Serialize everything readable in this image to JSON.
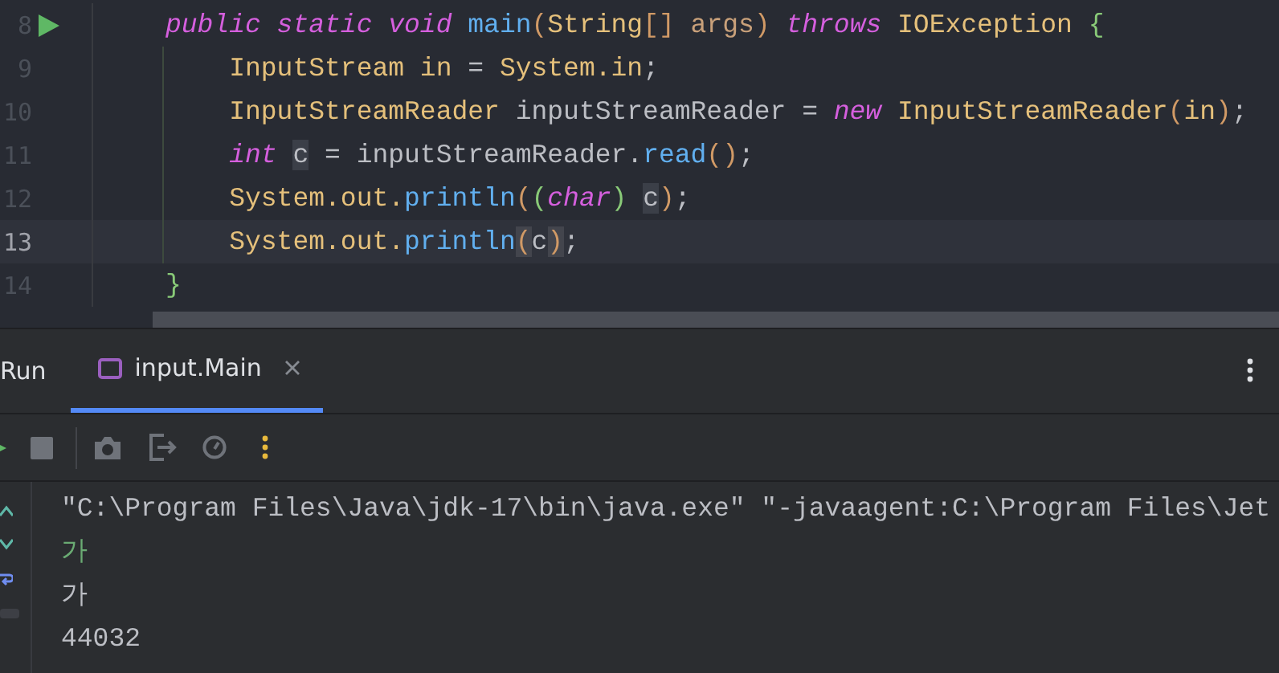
{
  "editor": {
    "lines": [
      {
        "number": "8",
        "current": false,
        "runnable": true,
        "tokens": [
          {
            "kind": "keyword",
            "text": "public static void "
          },
          {
            "kind": "method",
            "text": "main"
          },
          {
            "kind": "paren",
            "text": "("
          },
          {
            "kind": "type",
            "text": "String"
          },
          {
            "kind": "paren",
            "text": "[] "
          },
          {
            "kind": "param",
            "text": "args"
          },
          {
            "kind": "paren",
            "text": ") "
          },
          {
            "kind": "keyword",
            "text": "throws "
          },
          {
            "kind": "type",
            "text": "IOException "
          },
          {
            "kind": "brace",
            "text": "{"
          }
        ]
      },
      {
        "number": "9",
        "current": false,
        "runnable": false,
        "tokens": [
          {
            "kind": "type",
            "text": "    InputStream in"
          },
          {
            "kind": "plain",
            "text": " = "
          },
          {
            "kind": "type",
            "text": "System.in"
          },
          {
            "kind": "plain",
            "text": ";"
          }
        ]
      },
      {
        "number": "10",
        "current": false,
        "runnable": false,
        "tokens": [
          {
            "kind": "type",
            "text": "    InputStreamReader"
          },
          {
            "kind": "plain",
            "text": " inputStreamReader = "
          },
          {
            "kind": "keyword",
            "text": "new "
          },
          {
            "kind": "type",
            "text": "InputStreamReader"
          },
          {
            "kind": "paren",
            "text": "("
          },
          {
            "kind": "type",
            "text": "in"
          },
          {
            "kind": "paren",
            "text": ")"
          },
          {
            "kind": "plain",
            "text": ";"
          }
        ]
      },
      {
        "number": "11",
        "current": false,
        "runnable": false,
        "tokens": [
          {
            "kind": "keyword",
            "text": "    int "
          },
          {
            "kind": "highlight-var",
            "text": "c"
          },
          {
            "kind": "plain",
            "text": " = inputStreamReader."
          },
          {
            "kind": "method",
            "text": "read"
          },
          {
            "kind": "paren",
            "text": "()"
          },
          {
            "kind": "plain",
            "text": ";"
          }
        ]
      },
      {
        "number": "12",
        "current": false,
        "runnable": false,
        "tokens": [
          {
            "kind": "type",
            "text": "    System.out."
          },
          {
            "kind": "method",
            "text": "println"
          },
          {
            "kind": "paren",
            "text": "("
          },
          {
            "kind": "brace",
            "text": "("
          },
          {
            "kind": "keyword",
            "text": "char"
          },
          {
            "kind": "brace",
            "text": ") "
          },
          {
            "kind": "highlight-var",
            "text": "c"
          },
          {
            "kind": "paren",
            "text": ")"
          },
          {
            "kind": "plain",
            "text": ";"
          }
        ]
      },
      {
        "number": "13",
        "current": true,
        "runnable": false,
        "tokens": [
          {
            "kind": "type",
            "text": "    System.out."
          },
          {
            "kind": "method",
            "text": "println"
          },
          {
            "kind": "highlight-paren",
            "text": "("
          },
          {
            "kind": "plain",
            "text": "c"
          },
          {
            "kind": "highlight-paren",
            "text": ")"
          },
          {
            "kind": "plain",
            "text": ";"
          }
        ]
      },
      {
        "number": "14",
        "current": false,
        "runnable": false,
        "tokens": [
          {
            "kind": "brace",
            "text": "}"
          }
        ]
      }
    ]
  },
  "run_panel": {
    "title": "Run",
    "tabs": [
      {
        "label": "input.Main",
        "selected": true
      }
    ],
    "console": [
      {
        "kind": "command",
        "text": "\"C:\\Program Files\\Java\\jdk-17\\bin\\java.exe\" \"-javaagent:C:\\Program Files\\Jet"
      },
      {
        "kind": "input",
        "text": "가"
      },
      {
        "kind": "output",
        "text": "가"
      },
      {
        "kind": "output",
        "text": "44032"
      }
    ]
  }
}
